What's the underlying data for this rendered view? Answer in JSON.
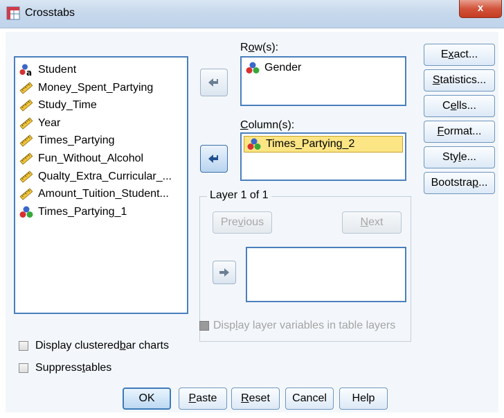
{
  "window": {
    "title": "Crosstabs",
    "close_glyph": "x"
  },
  "source_list": {
    "items": [
      {
        "label": "Student",
        "icon": "nominal-string-icon"
      },
      {
        "label": "Money_Spent_Partying",
        "icon": "scale-ruler-icon"
      },
      {
        "label": "Study_Time",
        "icon": "scale-ruler-icon"
      },
      {
        "label": "Year",
        "icon": "scale-ruler-icon"
      },
      {
        "label": "Times_Partying",
        "icon": "scale-ruler-icon"
      },
      {
        "label": "Fun_Without_Alcohol",
        "icon": "scale-ruler-icon"
      },
      {
        "label": "Qualty_Extra_Curricular_...",
        "icon": "scale-ruler-icon"
      },
      {
        "label": "Amount_Tuition_Student...",
        "icon": "scale-ruler-icon"
      },
      {
        "label": "Times_Partying_1",
        "icon": "nominal-balls-icon"
      }
    ]
  },
  "rows": {
    "label_pre": "R",
    "label_ul": "o",
    "label_post": "w(s):",
    "items": [
      "Gender"
    ]
  },
  "columns": {
    "label_pre": "",
    "label_ul": "C",
    "label_post": "olumn(s):",
    "items": [
      "Times_Partying_2"
    ]
  },
  "layer": {
    "legend": "Layer 1 of 1",
    "previous": {
      "pre": "Pre",
      "ul": "v",
      "post": "ious"
    },
    "next": {
      "pre": "",
      "ul": "N",
      "post": "ext"
    }
  },
  "side_buttons": [
    {
      "pre": "E",
      "ul": "x",
      "post": "act..."
    },
    {
      "pre": "",
      "ul": "S",
      "post": "tatistics..."
    },
    {
      "pre": "C",
      "ul": "e",
      "post": "lls..."
    },
    {
      "pre": "",
      "ul": "F",
      "post": "ormat..."
    },
    {
      "pre": "Sty",
      "ul": "l",
      "post": "e..."
    },
    {
      "pre": "Bootstra",
      "ul": "p",
      "post": "..."
    }
  ],
  "checkboxes": {
    "layer_vars": {
      "pre": "Disp",
      "ul": "l",
      "post": "ay layer variables in table layers",
      "checked": false,
      "disabled": true
    },
    "clustered": {
      "pre": "Display clustered ",
      "ul": "b",
      "post": "ar charts",
      "checked": false
    },
    "suppress": {
      "pre": "Suppress ",
      "ul": "t",
      "post": "ables",
      "checked": false
    }
  },
  "bottom_buttons": {
    "ok": {
      "pre": "OK",
      "ul": "",
      "post": ""
    },
    "paste": {
      "pre": "",
      "ul": "P",
      "post": "aste"
    },
    "reset": {
      "pre": "",
      "ul": "R",
      "post": "eset"
    },
    "cancel": {
      "pre": "Cancel",
      "ul": "",
      "post": ""
    },
    "help": {
      "pre": "Help",
      "ul": "",
      "post": ""
    }
  },
  "colors": {
    "accent": "#3d79b8",
    "selection": "#fbe584"
  }
}
